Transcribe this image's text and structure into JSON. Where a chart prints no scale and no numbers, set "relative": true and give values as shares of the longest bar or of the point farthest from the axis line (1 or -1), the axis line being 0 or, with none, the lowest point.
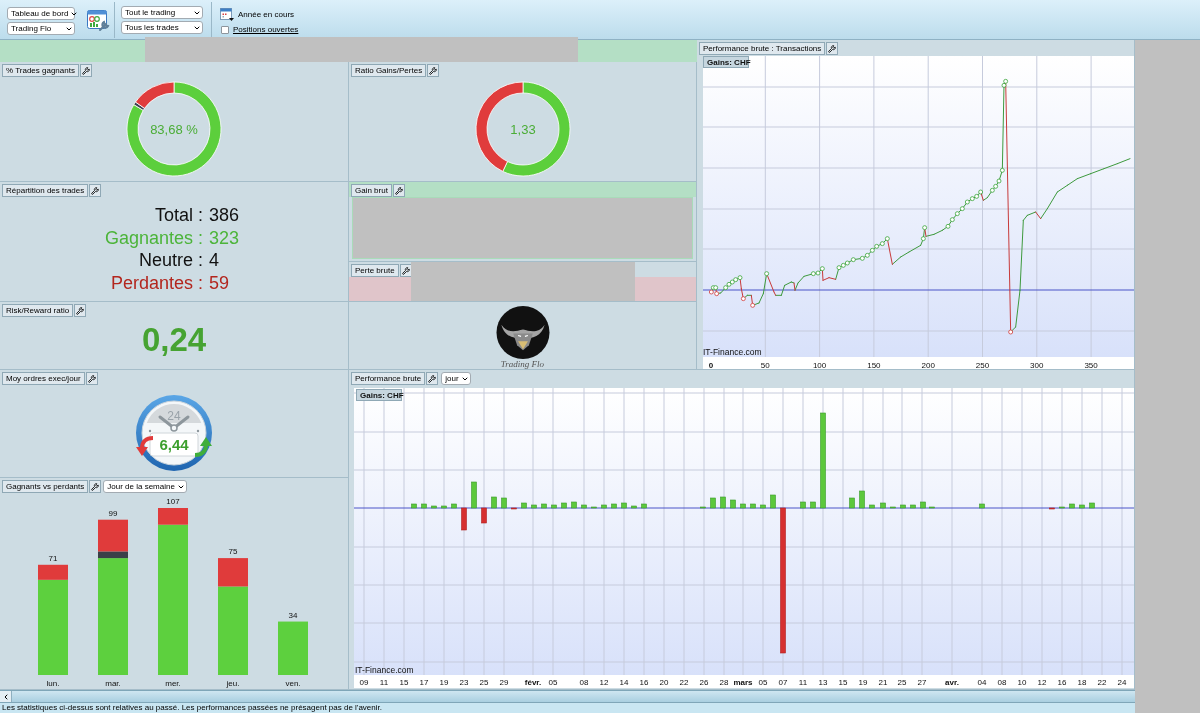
{
  "toolbar": {
    "dashboard_select": "Tableau de bord",
    "account_select": "Trading Flo",
    "scope_select": "Tout le trading",
    "trades_select": "Tous les trades",
    "period": "Année en cours",
    "open_positions": {
      "label": "Positions ouvertes",
      "checked": false
    }
  },
  "win_rate": {
    "title": "% Trades gagnants",
    "center_label": "83,68 %",
    "chart_data": {
      "type": "donut",
      "values": [
        83.68,
        1.04,
        15.28
      ],
      "colors": [
        "#5ccf3c",
        "#3b4150",
        "#e03c3c"
      ]
    }
  },
  "gain_loss_ratio": {
    "title": "Ratio Gains/Pertes",
    "center_label": "1,33",
    "chart_data": {
      "type": "donut",
      "values": [
        57.08,
        42.92
      ],
      "colors": [
        "#5ccf3c",
        "#e03c3c"
      ]
    }
  },
  "transactions_chart": {
    "title": "Performance brute : Transactions",
    "unit_label": "Gains: CHF",
    "source": "IT-Finance.com",
    "x_labels": [
      {
        "label": "0",
        "kind": "origin"
      },
      {
        "label": "50",
        "kind": "tick"
      },
      {
        "label": "100",
        "kind": "tick"
      },
      {
        "label": "150",
        "kind": "tick"
      },
      {
        "label": "200",
        "kind": "tick"
      },
      {
        "label": "250",
        "kind": "tick"
      },
      {
        "label": "300",
        "kind": "tick"
      },
      {
        "label": "350",
        "kind": "tick"
      }
    ]
  },
  "trade_breakdown": {
    "title": "Répartition des trades",
    "rows": [
      {
        "label": "Total :",
        "value": "386",
        "color": "#111111"
      },
      {
        "label": "Gagnantes :",
        "value": "323",
        "color": "#4cb43a"
      },
      {
        "label": "Neutre :",
        "value": "4",
        "color": "#111111"
      },
      {
        "label": "Perdantes :",
        "value": "59",
        "color": "#b3261e"
      }
    ]
  },
  "gross_gain": {
    "title": "Gain brut"
  },
  "gross_loss": {
    "title": "Perte brute"
  },
  "risk_reward": {
    "title": "Risk/Reward ratio",
    "value": "0,24"
  },
  "logo": {
    "text": "Trading Flo"
  },
  "orders_per_day": {
    "title": "Moy ordres exec/jour",
    "clock_number": "24",
    "value": "6,44"
  },
  "daily_performance": {
    "title": "Performance brute",
    "period_select": "jour",
    "unit_label": "Gains: CHF",
    "source": "IT-Finance.com",
    "x_labels": [
      {
        "label": "09",
        "kind": "day"
      },
      {
        "label": "11",
        "kind": "day"
      },
      {
        "label": "15",
        "kind": "day"
      },
      {
        "label": "17",
        "kind": "day"
      },
      {
        "label": "19",
        "kind": "day"
      },
      {
        "label": "23",
        "kind": "day"
      },
      {
        "label": "25",
        "kind": "day"
      },
      {
        "label": "29",
        "kind": "day"
      },
      {
        "label": "févr.",
        "kind": "month"
      },
      {
        "label": "05",
        "kind": "day"
      },
      {
        "label": "08",
        "kind": "day"
      },
      {
        "label": "12",
        "kind": "day"
      },
      {
        "label": "14",
        "kind": "day"
      },
      {
        "label": "16",
        "kind": "day"
      },
      {
        "label": "20",
        "kind": "day"
      },
      {
        "label": "22",
        "kind": "day"
      },
      {
        "label": "26",
        "kind": "day"
      },
      {
        "label": "28",
        "kind": "day"
      },
      {
        "label": "mars",
        "kind": "month"
      },
      {
        "label": "05",
        "kind": "day"
      },
      {
        "label": "07",
        "kind": "day"
      },
      {
        "label": "11",
        "kind": "day"
      },
      {
        "label": "13",
        "kind": "day"
      },
      {
        "label": "15",
        "kind": "day"
      },
      {
        "label": "19",
        "kind": "day"
      },
      {
        "label": "21",
        "kind": "day"
      },
      {
        "label": "25",
        "kind": "day"
      },
      {
        "label": "27",
        "kind": "day"
      },
      {
        "label": "avr.",
        "kind": "month"
      },
      {
        "label": "04",
        "kind": "day"
      },
      {
        "label": "08",
        "kind": "day"
      },
      {
        "label": "10",
        "kind": "day"
      },
      {
        "label": "12",
        "kind": "day"
      },
      {
        "label": "16",
        "kind": "day"
      },
      {
        "label": "18",
        "kind": "day"
      },
      {
        "label": "22",
        "kind": "day"
      },
      {
        "label": "24",
        "kind": "day"
      }
    ]
  },
  "winners_losers": {
    "title": "Gagnants vs perdants",
    "group_select": "Jour de la semaine",
    "bar_totals": [
      "71",
      "99",
      "107",
      "75",
      "34"
    ],
    "chart_data": {
      "type": "bar",
      "stacked": true,
      "relative": true,
      "categories": [
        "lun.",
        "mar.",
        "mer.",
        "jeu.",
        "ven."
      ],
      "series": [
        {
          "color": "#5dd03e",
          "values": [
            0.57,
            0.7,
            0.9,
            0.53,
            0.32
          ]
        },
        {
          "color": "#3b3f48",
          "values": [
            0,
            0.04,
            0,
            0,
            0
          ]
        },
        {
          "color": "#e03b3b",
          "values": [
            0.09,
            0.19,
            0.1,
            0.17,
            0
          ]
        }
      ]
    }
  },
  "status_bar": {
    "text": "Les statistiques ci-dessus sont relatives au passé. Les performances passées ne présagent pas de l'avenir."
  }
}
